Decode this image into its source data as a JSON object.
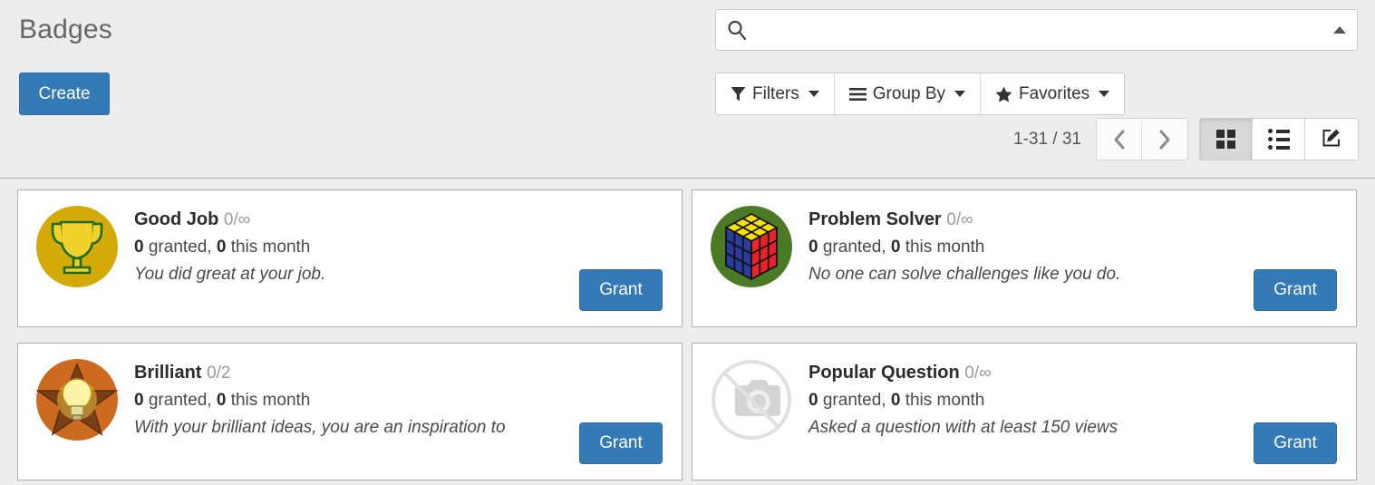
{
  "header": {
    "title": "Badges",
    "create_label": "Create"
  },
  "search": {
    "value": "",
    "placeholder": "",
    "icon": "search-icon",
    "toggle_icon": "caret-up-icon"
  },
  "toolbar": {
    "buttons": [
      {
        "label": "Filters",
        "icon": "filter-funnel-icon"
      },
      {
        "label": "Group By",
        "icon": "hamburger-menu-icon"
      },
      {
        "label": "Favorites",
        "icon": "star-icon"
      }
    ]
  },
  "pager": {
    "count": "1-31 / 31",
    "previous_icon": "chevron-left-icon",
    "next_icon": "chevron-right-icon"
  },
  "views": [
    {
      "name": "kanban",
      "icon": "grid-view-icon",
      "active": true
    },
    {
      "name": "list",
      "icon": "list-view-icon",
      "active": false
    },
    {
      "name": "form",
      "icon": "edit-pencil-icon",
      "active": false
    }
  ],
  "colors": {
    "accent": "#337ab7",
    "page_background": "#ededed",
    "card_background": "#ffffff",
    "card_border": "#b1b1b1",
    "title_text": "#666666"
  },
  "cards": [
    {
      "title": "Good Job",
      "quota": "0/∞",
      "granted": "0",
      "granted_label": " granted, ",
      "month_count": "0",
      "month_label": " this month",
      "description": "You did great at your job.",
      "grant_label": "Grant",
      "image": "trophy-badge-icon"
    },
    {
      "title": "Problem Solver",
      "quota": "0/∞",
      "granted": "0",
      "granted_label": " granted, ",
      "month_count": "0",
      "month_label": " this month",
      "description": "No one can solve challenges like you do.",
      "grant_label": "Grant",
      "image": "rubiks-cube-badge-icon"
    },
    {
      "title": "Brilliant",
      "quota": "0/2",
      "granted": "0",
      "granted_label": " granted, ",
      "month_count": "0",
      "month_label": " this month",
      "description": "With your brilliant ideas, you are an inspiration to",
      "grant_label": "Grant",
      "image": "lightbulb-star-badge-icon"
    },
    {
      "title": "Popular Question",
      "quota": "0/∞",
      "granted": "0",
      "granted_label": " granted, ",
      "month_count": "0",
      "month_label": " this month",
      "description": "Asked a question with at least 150 views",
      "grant_label": "Grant",
      "image": "broken-image-placeholder-icon"
    }
  ]
}
